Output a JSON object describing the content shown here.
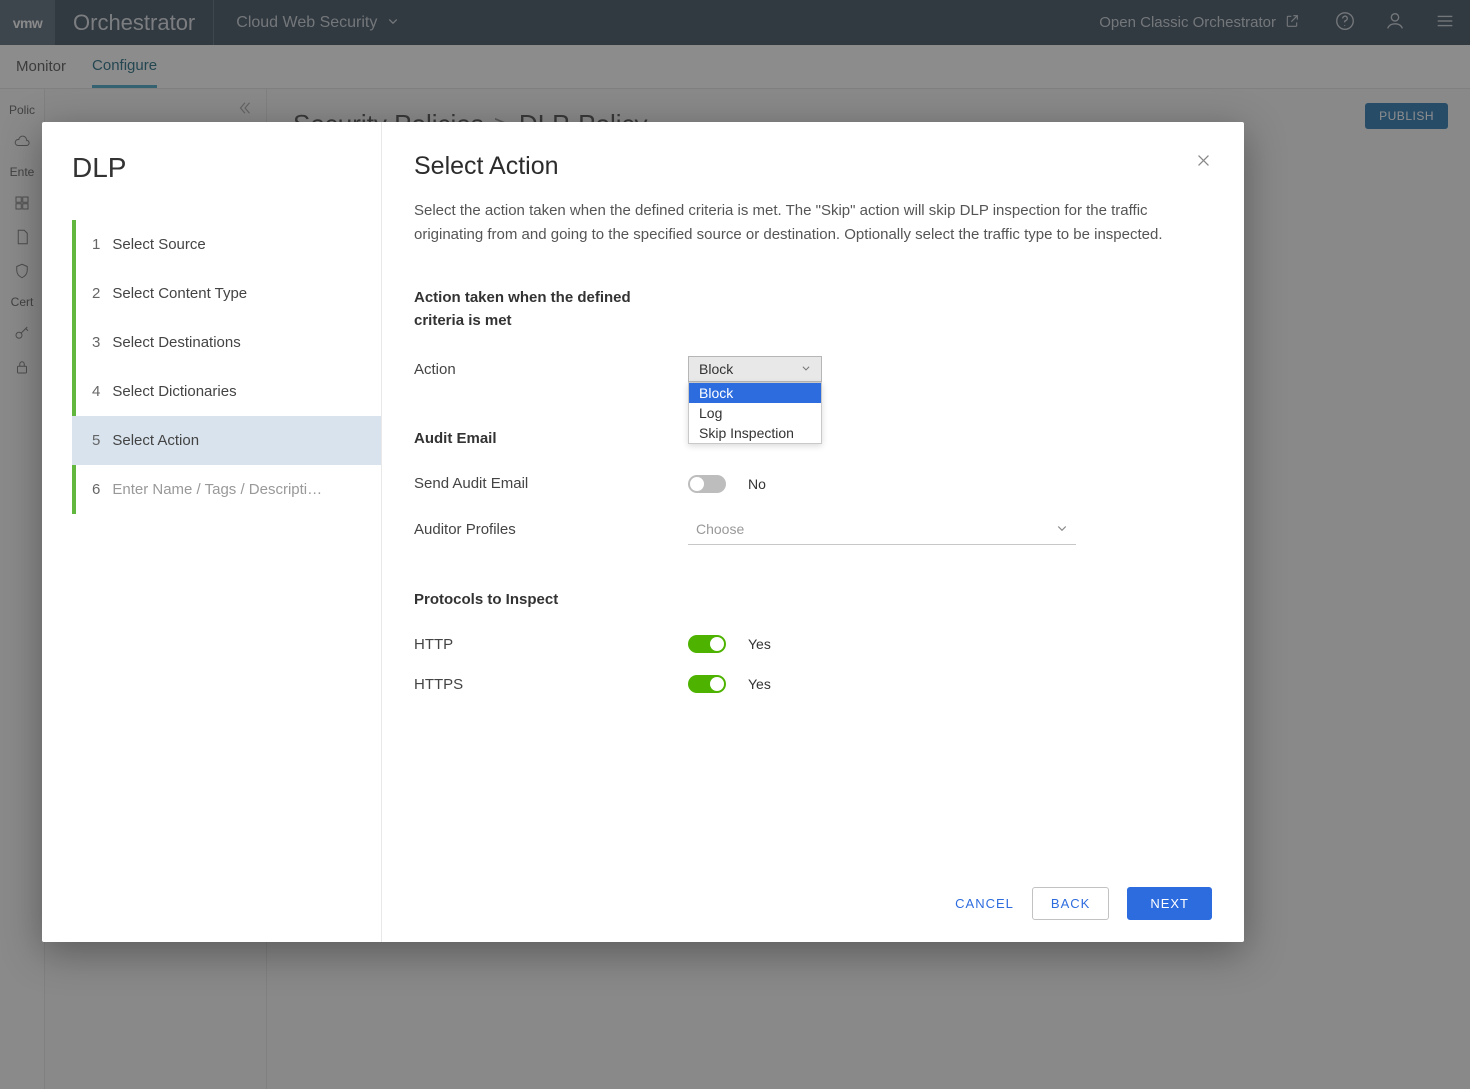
{
  "topbar": {
    "vmw": "vmw",
    "brand": "Orchestrator",
    "product": "Cloud Web Security",
    "classic_link": "Open Classic Orchestrator"
  },
  "tabs": {
    "monitor": "Monitor",
    "configure": "Configure"
  },
  "leftrail": {
    "policies": "Polic",
    "enterprise": "Ente",
    "cert": "Cert"
  },
  "breadcrumb": {
    "root": "Security Policies",
    "sep": ">",
    "leaf": "DLP-Policy"
  },
  "publish": "PUBLISH",
  "modal": {
    "left_title": "DLP",
    "steps": [
      {
        "num": "1",
        "label": "Select Source",
        "state": "done"
      },
      {
        "num": "2",
        "label": "Select Content Type",
        "state": "done"
      },
      {
        "num": "3",
        "label": "Select Destinations",
        "state": "done"
      },
      {
        "num": "4",
        "label": "Select Dictionaries",
        "state": "done"
      },
      {
        "num": "5",
        "label": "Select Action",
        "state": "active"
      },
      {
        "num": "6",
        "label": "Enter Name / Tags / Descripti…",
        "state": "future"
      }
    ],
    "title": "Select Action",
    "description": "Select the action taken when the defined criteria is met. The \"Skip\" action will skip DLP inspection for the traffic originating from and going to the specified source or destination. Optionally select the traffic type to be inspected.",
    "section_action_title": "Action taken when the defined criteria is met",
    "action_label": "Action",
    "action_value": "Block",
    "action_options": [
      "Block",
      "Log",
      "Skip Inspection"
    ],
    "section_audit_title": "Audit Email",
    "send_audit_label": "Send Audit Email",
    "send_audit_value": "No",
    "auditor_label": "Auditor Profiles",
    "auditor_placeholder": "Choose",
    "section_protocols_title": "Protocols to Inspect",
    "http_label": "HTTP",
    "http_value": "Yes",
    "https_label": "HTTPS",
    "https_value": "Yes",
    "footer": {
      "cancel": "CANCEL",
      "back": "BACK",
      "next": "NEXT"
    }
  }
}
